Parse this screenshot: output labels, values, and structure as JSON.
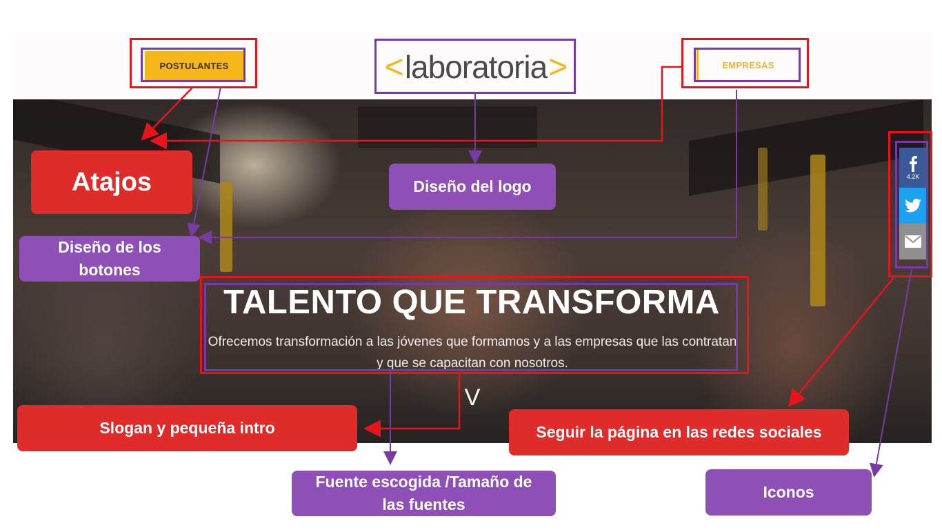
{
  "header": {
    "postulantes_label": "POSTULANTES",
    "empresas_label": "EMPRESAS",
    "logo": {
      "left_bracket": "<",
      "word": "laboratoria",
      "right_bracket": ">"
    }
  },
  "hero": {
    "title": "TALENTO QUE TRANSFORMA",
    "intro": "Ofrecemos transformación a las jóvenes que formamos y a las empresas que las contratan y que se capacitan con nosotros.",
    "scroll_indicator": "V"
  },
  "social": {
    "facebook_count": "4.2K",
    "icons": [
      "facebook-icon",
      "twitter-icon",
      "mail-icon"
    ]
  },
  "annotations": {
    "atajos": "Atajos",
    "diseno_logo": "Diseño del logo",
    "diseno_botones": "Diseño de los botones",
    "slogan": "Slogan y pequeña intro",
    "fuente": "Fuente escogida /Tamaño de las fuentes",
    "seguir": "Seguir la página en las redes sociales",
    "iconos": "Iconos"
  },
  "colors": {
    "brand_yellow": "#f6b71b",
    "annotation_red": "#e02b2b",
    "annotation_purple": "#8e4fb7",
    "outline_red": "#e8141c",
    "outline_purple": "#7a3aa6",
    "facebook": "#3b5998",
    "twitter": "#1da1f2",
    "mail": "#8f8f8f"
  }
}
